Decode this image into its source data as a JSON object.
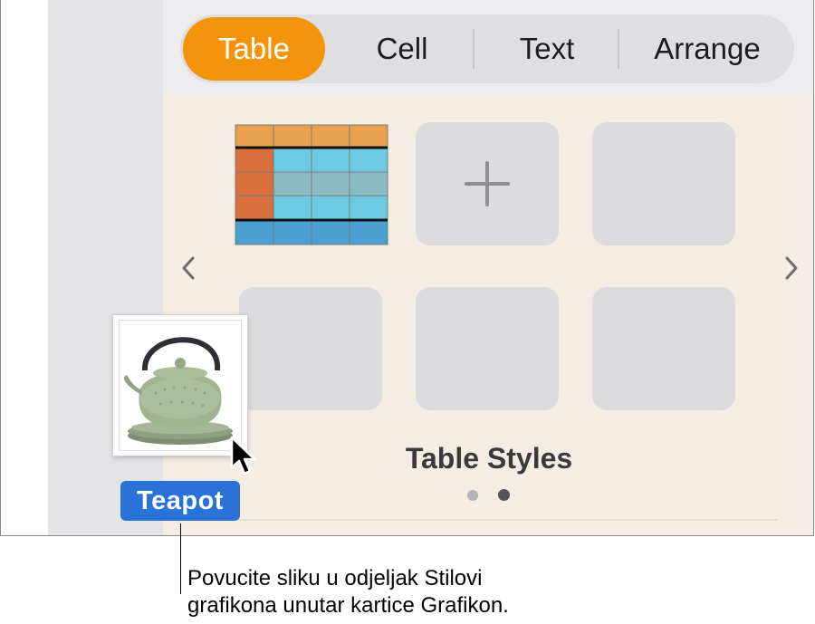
{
  "tabs": [
    {
      "label": "Table",
      "active": true
    },
    {
      "label": "Cell",
      "active": false
    },
    {
      "label": "Text",
      "active": false
    },
    {
      "label": "Arrange",
      "active": false
    }
  ],
  "styles_section": {
    "title": "Table Styles",
    "page_count": 2,
    "current_page": 2,
    "add_style_icon": "plus-icon",
    "prev_icon": "chevron-left-icon",
    "next_icon": "chevron-right-icon"
  },
  "drag": {
    "label": "Teapot",
    "image": "teapot-photo",
    "cursor": "arrow-cursor-icon"
  },
  "callout": {
    "line1": "Povucite sliku u odjeljak Stilovi",
    "line2": "grafikona unutar kartice Grafikon."
  },
  "colors": {
    "accent_tab": "#f5930a",
    "drag_label": "#2a72d8",
    "styles_background": "#f3ede4"
  }
}
